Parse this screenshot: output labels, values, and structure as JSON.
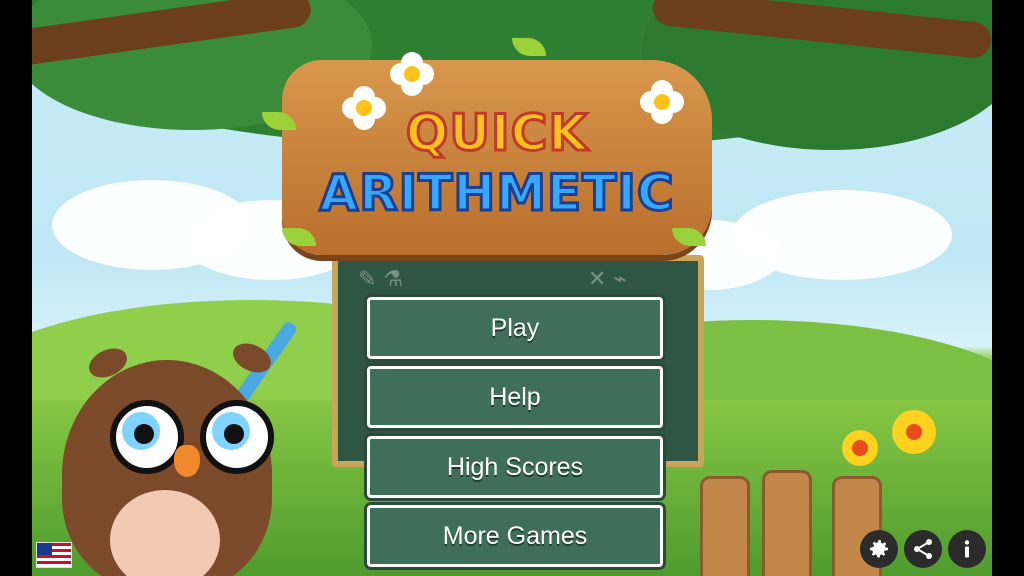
{
  "game": {
    "title_line1": "QUICK",
    "title_line2": "ARITHMETIC"
  },
  "menu": {
    "play": "Play",
    "help": "Help",
    "high_scores": "High Scores",
    "more_games": "More Games"
  },
  "bottom_bar": {
    "language_flag": "us-flag-icon",
    "settings_icon": "gear-icon",
    "share_icon": "share-icon",
    "info_icon": "info-icon"
  },
  "colors": {
    "title_yellow": "#ffc21a",
    "title_blue": "#35a8ff",
    "chalkboard": "#2f5544",
    "button_fill": "#3f6f5a"
  }
}
